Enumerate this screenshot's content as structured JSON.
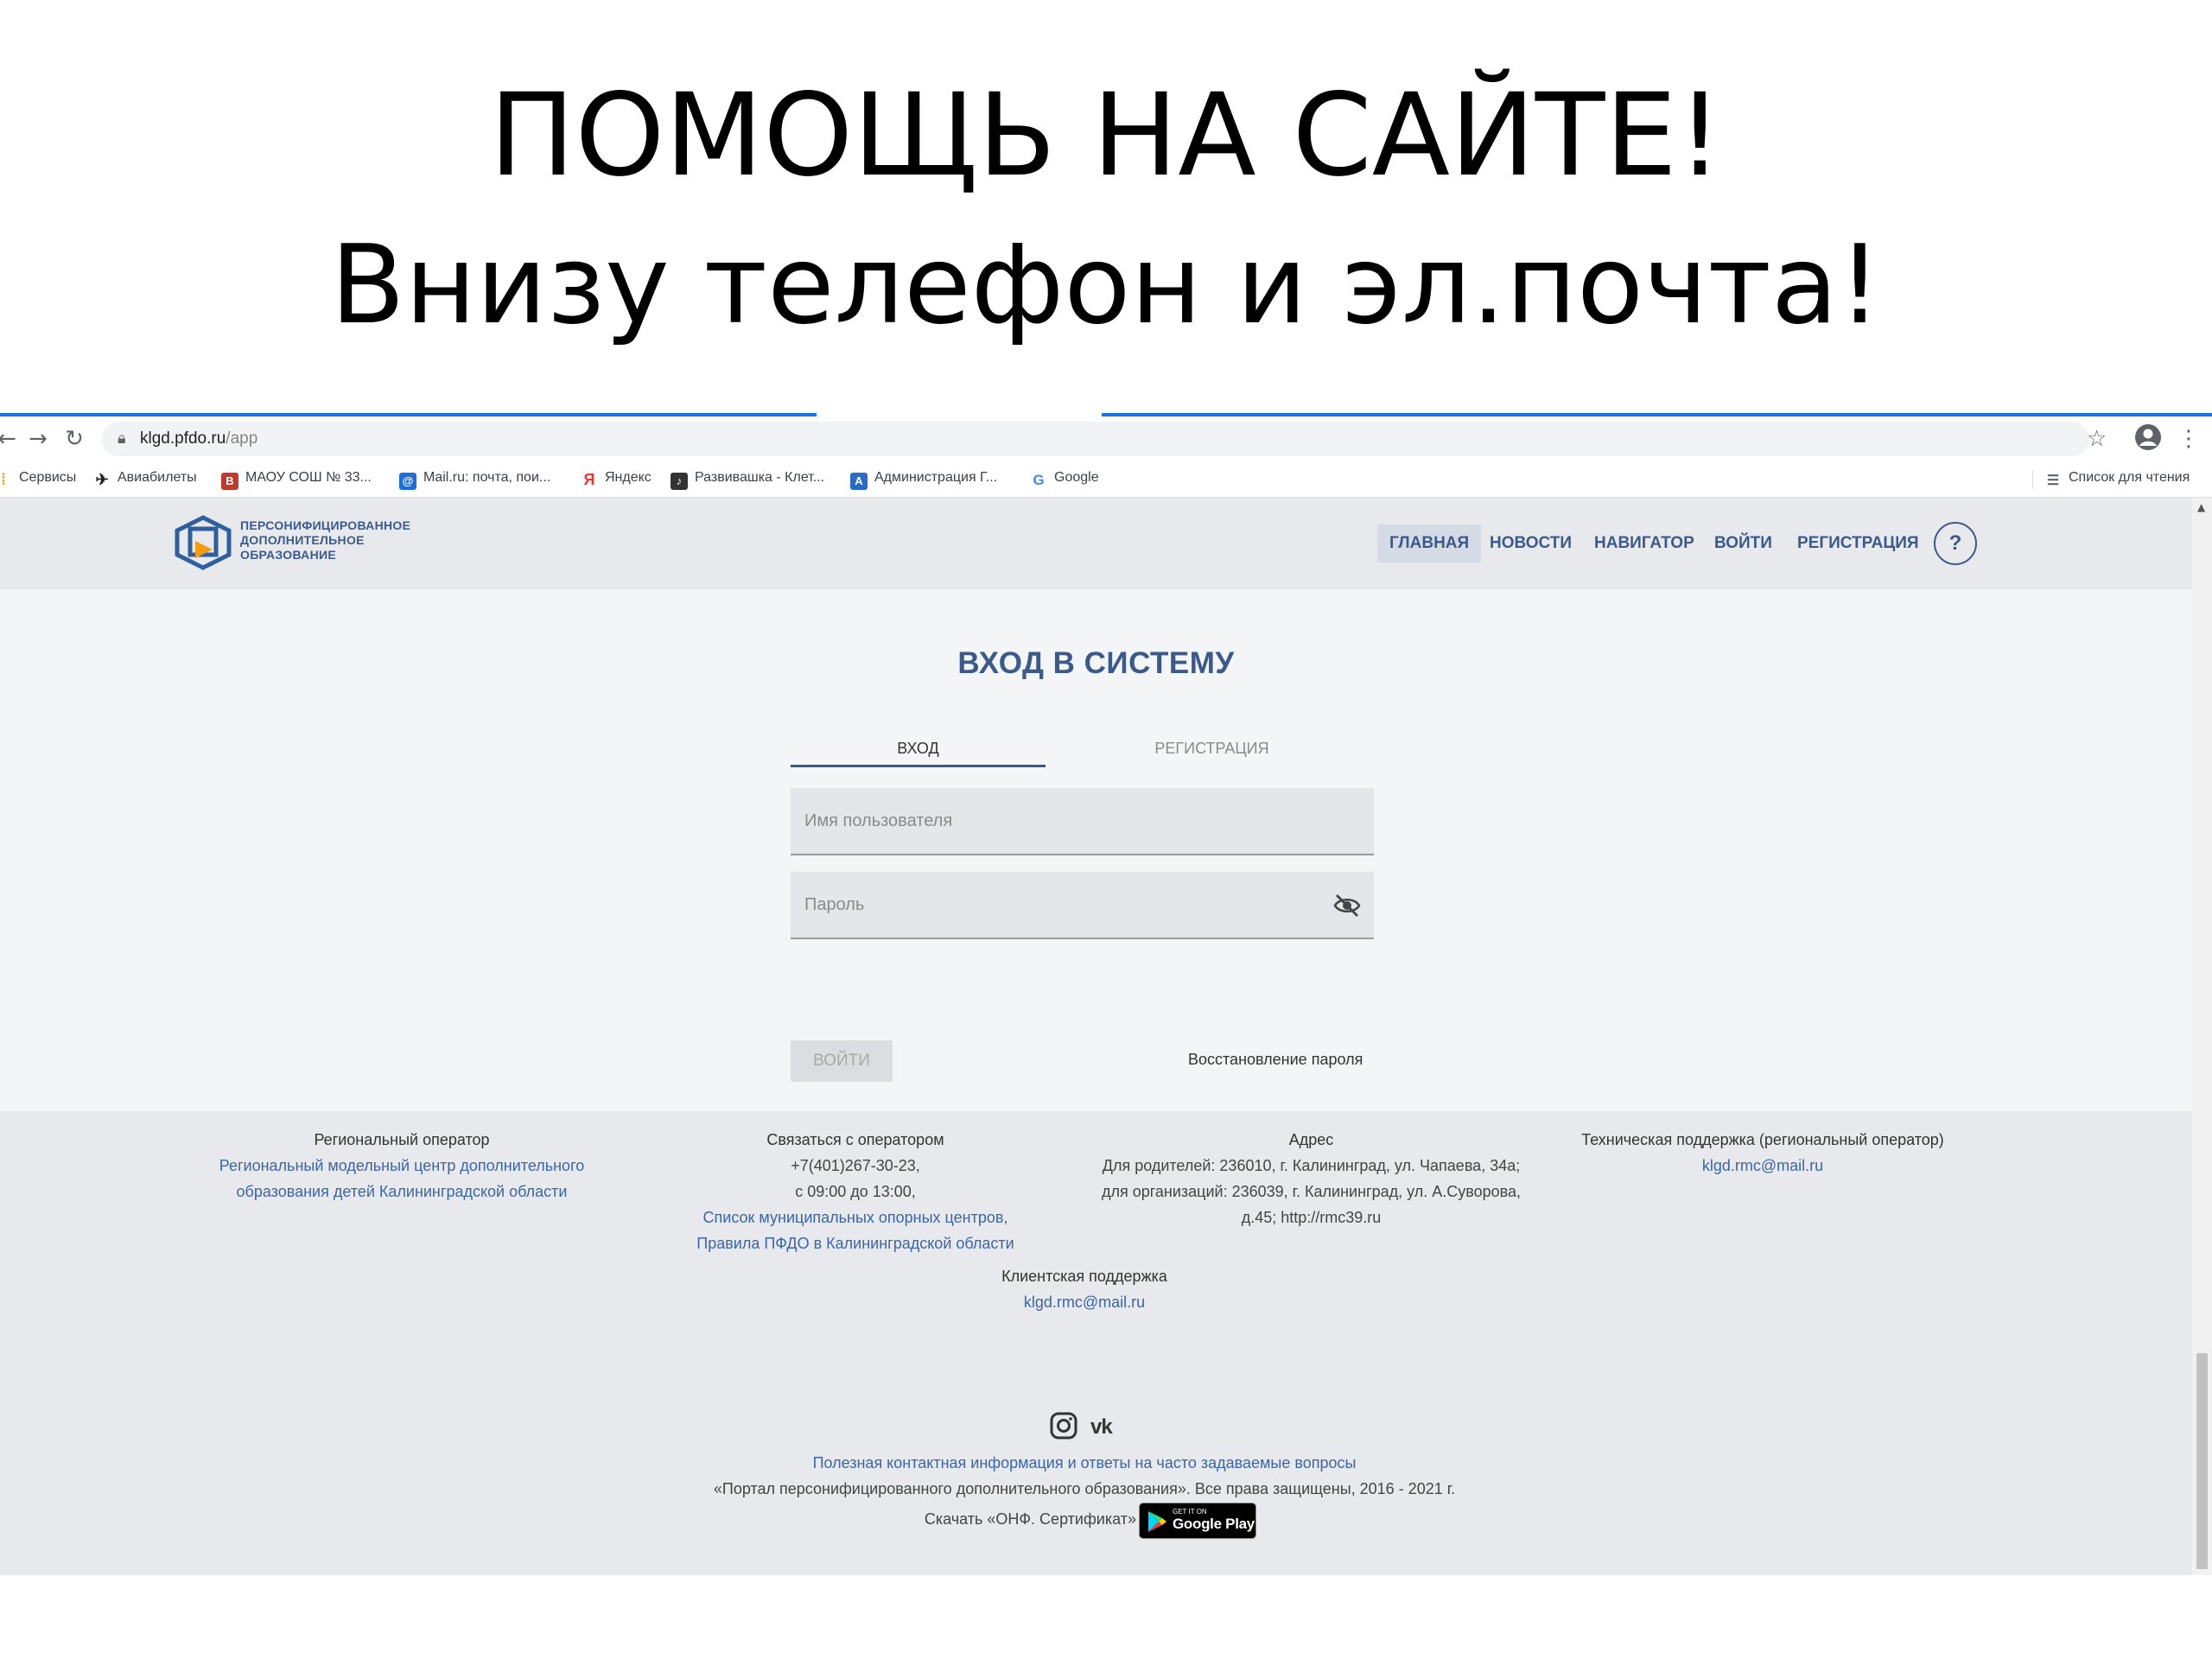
{
  "slide": {
    "title_line1": "ПОМОЩЬ НА  САЙТЕ!",
    "title_line2": "Внизу телефон и эл.почта!"
  },
  "browser": {
    "url_host": "klgd.pfdo.ru",
    "url_path": "/app",
    "back_icon": "arrow-left-icon",
    "forward_icon": "arrow-right-icon",
    "reload_icon": "reload-icon",
    "bookmarks": [
      {
        "label": "Сервисы",
        "icon": "apps-grid-icon"
      },
      {
        "label": "Авиабилеты",
        "icon": "plane-icon"
      },
      {
        "label": "МАОУ СОШ № 33...",
        "icon": "b-icon"
      },
      {
        "label": "Mail.ru: почта, пои...",
        "icon": "mailru-icon"
      },
      {
        "label": "Яндекс",
        "icon": "yandex-icon"
      },
      {
        "label": "Развивашка - Клет...",
        "icon": "music-icon"
      },
      {
        "label": "Администрация Г...",
        "icon": "admin-icon"
      },
      {
        "label": "Google",
        "icon": "google-icon"
      }
    ],
    "reading_list": "Список для чтения"
  },
  "site": {
    "logo_text": [
      "ПЕРСОНИФИЦИРОВАННОЕ",
      "ДОПОЛНИТЕЛЬНОЕ",
      "ОБРАЗОВАНИЕ"
    ],
    "nav": [
      "ГЛАВНАЯ",
      "НОВОСТИ",
      "НАВИГАТОР",
      "ВОЙТИ",
      "РЕГИСТРАЦИЯ"
    ],
    "help": "?",
    "login": {
      "title": "ВХОД В СИСТЕМУ",
      "tab_login": "ВХОД",
      "tab_register": "РЕГИСТРАЦИЯ",
      "username_placeholder": "Имя пользователя",
      "password_placeholder": "Пароль",
      "submit": "ВОЙТИ",
      "recover": "Восстановление пароля"
    },
    "footer": {
      "operator_head": "Региональный оператор",
      "operator_link1": "Региональный модельный центр дополнительного",
      "operator_link2": "образования детей Калининградской области",
      "contact_head": "Связаться с оператором",
      "contact_phone": "+7(401)267-30-23,",
      "contact_hours": "с 09:00 до 13:00,",
      "contact_link1": "Список муниципальных опорных центров,",
      "contact_link2": "Правила ПФДО в Калининградской области",
      "address_head": "Адрес",
      "address_line1": "Для родителей: 236010, г. Калининград, ул. Чапаева, 34а;",
      "address_line2": "для организаций: 236039, г. Калининград, ул. А.Суворова,",
      "address_line3": "д.45; http://rmc39.ru",
      "tech_head": "Техническая поддержка (региональный оператор)",
      "tech_email": "klgd.rmc@mail.ru",
      "client_head": "Клиентская поддержка",
      "client_email": "klgd.rmc@mail.ru",
      "faq_link": "Полезная контактная информация и ответы на часто задаваемые вопросы",
      "copyright": "«Портал персонифицированного дополнительного образования». Все права защищены, 2016 - 2021 г.",
      "download": "Скачать «ОНФ. Сертификат»",
      "gplay_small": "GET IT ON",
      "gplay_big": "Google Play"
    }
  }
}
